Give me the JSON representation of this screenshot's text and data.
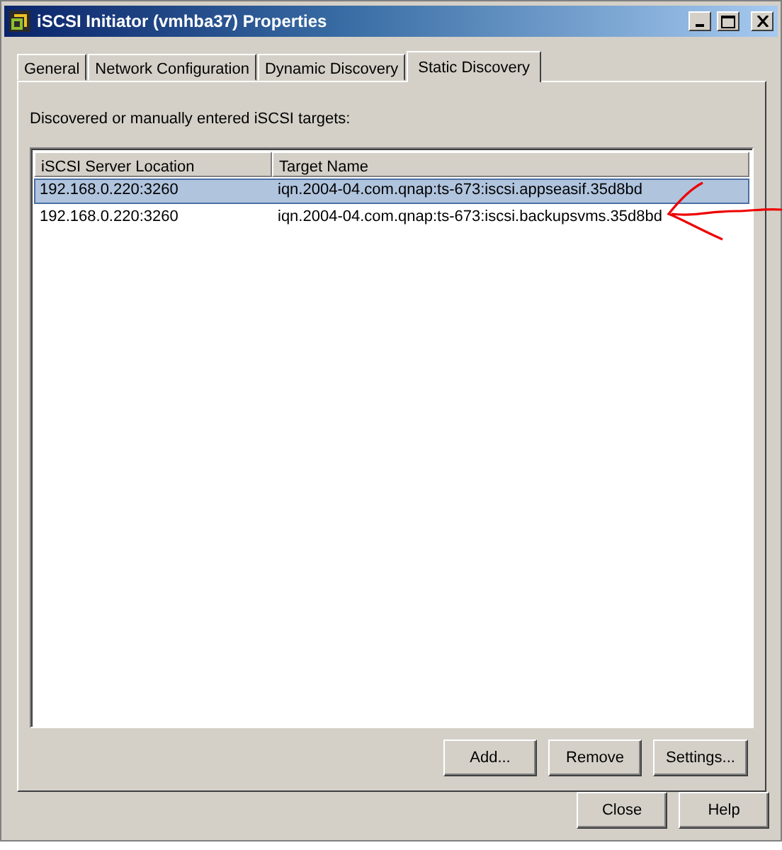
{
  "window": {
    "title": "iSCSI Initiator (vmhba37) Properties"
  },
  "tabs": [
    {
      "label": "General",
      "selected": false
    },
    {
      "label": "Network Configuration",
      "selected": false
    },
    {
      "label": "Dynamic Discovery",
      "selected": false
    },
    {
      "label": "Static Discovery",
      "selected": true
    }
  ],
  "description": "Discovered or manually entered iSCSI targets:",
  "table": {
    "columns": [
      "iSCSI Server Location",
      "Target Name"
    ],
    "rows": [
      {
        "cells": [
          "192.168.0.220:3260",
          "iqn.2004-04.com.qnap:ts-673:iscsi.appseasif.35d8bd"
        ],
        "selected": true
      },
      {
        "cells": [
          "192.168.0.220:3260",
          "iqn.2004-04.com.qnap:ts-673:iscsi.backupsvms.35d8bd"
        ],
        "selected": false
      }
    ]
  },
  "panel_buttons": [
    "Add...",
    "Remove",
    "Settings..."
  ],
  "dialog_buttons": [
    "Close",
    "Help"
  ]
}
